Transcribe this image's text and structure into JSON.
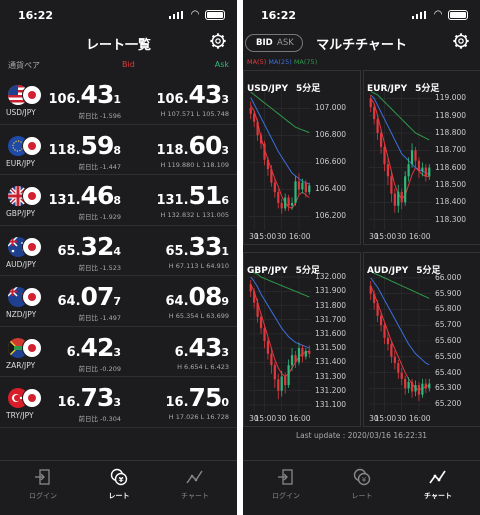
{
  "left": {
    "time": "16:22",
    "title": "レート一覧",
    "columns": {
      "pair": "通貨ペア",
      "bid": "Bid",
      "ask": "Ask"
    },
    "rows": [
      {
        "pair": "USD/JPY",
        "flag": "us-flag",
        "bid": {
          "pre": "106.",
          "big": "43",
          "last": "1"
        },
        "ask": {
          "pre": "106.",
          "big": "43",
          "last": "3"
        },
        "change": "前日比 -1.596",
        "hl": "H 107.571  L 105.748"
      },
      {
        "pair": "EUR/JPY",
        "flag": "eu-flag",
        "bid": {
          "pre": "118.",
          "big": "59",
          "last": "8"
        },
        "ask": {
          "pre": "118.",
          "big": "60",
          "last": "3"
        },
        "change": "前日比 -1.447",
        "hl": "H 119.880  L 118.109"
      },
      {
        "pair": "GBP/JPY",
        "flag": "uk-flag",
        "bid": {
          "pre": "131.",
          "big": "46",
          "last": "8"
        },
        "ask": {
          "pre": "131.",
          "big": "51",
          "last": "6"
        },
        "change": "前日比 -1.929",
        "hl": "H 132.832  L 131.005"
      },
      {
        "pair": "AUD/JPY",
        "flag": "au-flag",
        "bid": {
          "pre": "65.",
          "big": "32",
          "last": "4"
        },
        "ask": {
          "pre": "65.",
          "big": "33",
          "last": "1"
        },
        "change": "前日比 -1.523",
        "hl": "H 67.113  L 64.910"
      },
      {
        "pair": "NZD/JPY",
        "flag": "nz-flag",
        "bid": {
          "pre": "64.",
          "big": "07",
          "last": "7"
        },
        "ask": {
          "pre": "64.",
          "big": "08",
          "last": "9"
        },
        "change": "前日比 -1.497",
        "hl": "H 65.354  L 63.699"
      },
      {
        "pair": "ZAR/JPY",
        "flag": "za-flag",
        "bid": {
          "pre": "6.",
          "big": "42",
          "last": "3"
        },
        "ask": {
          "pre": "6.",
          "big": "43",
          "last": "3"
        },
        "change": "前日比 -0.209",
        "hl": "H 6.654  L 6.423"
      },
      {
        "pair": "TRY/JPY",
        "flag": "tr-flag",
        "bid": {
          "pre": "16.",
          "big": "73",
          "last": "3"
        },
        "ask": {
          "pre": "16.",
          "big": "75",
          "last": "0"
        },
        "change": "前日比 -0.304",
        "hl": "H 17.026  L 16.728"
      }
    ],
    "tabs": [
      {
        "label": "ログイン",
        "icon": "login-icon"
      },
      {
        "label": "レート",
        "icon": "rate-icon"
      },
      {
        "label": "チャート",
        "icon": "chart-icon"
      }
    ],
    "active_tab": "レート"
  },
  "right": {
    "time": "16:22",
    "title": "マルチチャート",
    "toggle": {
      "bid": "BID",
      "ask": "ASK"
    },
    "ma": [
      {
        "label": "MA(5)",
        "color": "#e0383e"
      },
      {
        "label": "MA(25)",
        "color": "#3b6fe0"
      },
      {
        "label": "MA(75)",
        "color": "#2e9a4a"
      }
    ],
    "last_update": "Last update : 2020/03/16 16:22:31",
    "tabs": [
      {
        "label": "ログイン",
        "icon": "login-icon"
      },
      {
        "label": "レート",
        "icon": "rate-icon"
      },
      {
        "label": "チャート",
        "icon": "chart-icon"
      }
    ],
    "active_tab": "チャート"
  },
  "colors": {
    "bid": "#e0383e",
    "ask": "#2eb87a",
    "background": "#1c1c1e",
    "candle_up": "#2eb87a",
    "candle_down": "#e0383e"
  },
  "chart_data": [
    {
      "type": "candlestick",
      "title": "USD/JPY",
      "interval": "5分足",
      "yticks": [
        "107.000",
        "106.800",
        "106.600",
        "106.400",
        "106.200"
      ],
      "ylim": [
        106.1,
        107.15
      ],
      "xticks": [
        "30",
        "15:00",
        "30",
        "16:00"
      ],
      "ma": {
        "MA(5)": [
          107.02,
          106.98,
          106.9,
          106.78,
          106.7,
          106.62,
          106.55,
          106.48,
          106.42,
          106.35,
          106.3,
          106.27,
          106.26,
          106.3,
          106.36,
          106.38,
          106.36,
          106.34
        ],
        "MA(25)": [
          107.08,
          107.03,
          106.98,
          106.93,
          106.88,
          106.83,
          106.78,
          106.73,
          106.68,
          106.64,
          106.6,
          106.56,
          106.52,
          106.5,
          106.48,
          106.46,
          106.45,
          106.44
        ],
        "MA(75)": [
          107.12,
          107.1,
          107.08,
          107.06,
          107.04,
          107.02,
          107.0,
          106.98,
          106.96,
          106.94,
          106.92,
          106.9,
          106.88,
          106.86,
          106.85,
          106.84,
          106.83,
          106.82
        ]
      },
      "candles": [
        [
          107.0,
          106.96,
          107.05,
          106.92
        ],
        [
          106.96,
          106.9,
          106.98,
          106.86
        ],
        [
          106.9,
          106.8,
          106.92,
          106.76
        ],
        [
          106.8,
          106.74,
          106.82,
          106.7
        ],
        [
          106.74,
          106.62,
          106.76,
          106.58
        ],
        [
          106.62,
          106.55,
          106.64,
          106.5
        ],
        [
          106.55,
          106.45,
          106.58,
          106.42
        ],
        [
          106.45,
          106.38,
          106.48,
          106.34
        ],
        [
          106.38,
          106.3,
          106.4,
          106.26
        ],
        [
          106.3,
          106.26,
          106.33,
          106.22
        ],
        [
          106.26,
          106.34,
          106.37,
          106.24
        ],
        [
          106.34,
          106.28,
          106.36,
          106.24
        ],
        [
          106.28,
          106.3,
          106.34,
          106.25
        ],
        [
          106.3,
          106.46,
          106.5,
          106.28
        ],
        [
          106.46,
          106.4,
          106.52,
          106.36
        ],
        [
          106.4,
          106.45,
          106.48,
          106.37
        ],
        [
          106.45,
          106.38,
          106.47,
          106.34
        ],
        [
          106.38,
          106.43,
          106.45,
          106.36
        ]
      ]
    },
    {
      "type": "candlestick",
      "title": "EUR/JPY",
      "interval": "5分足",
      "yticks": [
        "119.000",
        "118.900",
        "118.800",
        "118.700",
        "118.600",
        "118.500",
        "118.400",
        "118.300"
      ],
      "ylim": [
        118.24,
        119.06
      ],
      "xticks": [
        "30",
        "15:00",
        "30",
        "16:00"
      ],
      "ma": {
        "MA(5)": [
          119.0,
          118.97,
          118.9,
          118.82,
          118.74,
          118.66,
          118.58,
          118.5,
          118.45,
          118.42,
          118.44,
          118.5,
          118.56,
          118.6,
          118.58,
          118.56,
          118.55,
          118.55
        ],
        "MA(25)": [
          119.02,
          119.0,
          118.96,
          118.92,
          118.88,
          118.84,
          118.8,
          118.76,
          118.72,
          118.68,
          118.66,
          118.64,
          118.62,
          118.6,
          118.59,
          118.58,
          118.57,
          118.56
        ],
        "MA(75)": [
          119.04,
          119.03,
          119.02,
          119.0,
          118.98,
          118.96,
          118.94,
          118.92,
          118.9,
          118.88,
          118.86,
          118.84,
          118.82,
          118.8,
          118.79,
          118.78,
          118.77,
          118.76
        ]
      },
      "candles": [
        [
          119.0,
          118.95,
          119.02,
          118.92
        ],
        [
          118.95,
          118.88,
          118.97,
          118.85
        ],
        [
          118.88,
          118.8,
          118.9,
          118.76
        ],
        [
          118.8,
          118.72,
          118.82,
          118.68
        ],
        [
          118.72,
          118.62,
          118.74,
          118.58
        ],
        [
          118.62,
          118.55,
          118.66,
          118.5
        ],
        [
          118.55,
          118.45,
          118.58,
          118.4
        ],
        [
          118.45,
          118.38,
          118.48,
          118.34
        ],
        [
          118.38,
          118.46,
          118.5,
          118.34
        ],
        [
          118.46,
          118.4,
          118.48,
          118.36
        ],
        [
          118.4,
          118.55,
          118.58,
          118.38
        ],
        [
          118.55,
          118.62,
          118.66,
          118.52
        ],
        [
          118.62,
          118.7,
          118.74,
          118.6
        ],
        [
          118.7,
          118.64,
          118.72,
          118.6
        ],
        [
          118.64,
          118.58,
          118.66,
          118.54
        ],
        [
          118.58,
          118.6,
          118.63,
          118.55
        ],
        [
          118.6,
          118.55,
          118.62,
          118.52
        ],
        [
          118.55,
          118.6,
          118.62,
          118.53
        ]
      ]
    },
    {
      "type": "candlestick",
      "title": "GBP/JPY",
      "interval": "5分足",
      "yticks": [
        "132.000",
        "131.900",
        "131.800",
        "131.700",
        "131.600",
        "131.500",
        "131.400",
        "131.300",
        "131.200",
        "131.100"
      ],
      "ylim": [
        131.05,
        132.05
      ],
      "xticks": [
        "30",
        "15:00",
        "30",
        "16:00"
      ],
      "ma": {
        "MA(5)": [
          131.95,
          131.9,
          131.82,
          131.74,
          131.66,
          131.58,
          131.5,
          131.42,
          131.36,
          131.32,
          131.3,
          131.32,
          131.36,
          131.4,
          131.44,
          131.46,
          131.47,
          131.48
        ],
        "MA(25)": [
          132.0,
          131.97,
          131.93,
          131.88,
          131.84,
          131.8,
          131.76,
          131.72,
          131.68,
          131.64,
          131.61,
          131.58,
          131.56,
          131.54,
          131.53,
          131.52,
          131.51,
          131.5
        ],
        "MA(75)": [
          132.04,
          132.03,
          132.02,
          132.0,
          131.99,
          131.98,
          131.97,
          131.96,
          131.95,
          131.94,
          131.93,
          131.92,
          131.91,
          131.9,
          131.89,
          131.88,
          131.87,
          131.86
        ]
      },
      "candles": [
        [
          131.95,
          131.9,
          131.98,
          131.86
        ],
        [
          131.9,
          131.82,
          131.92,
          131.78
        ],
        [
          131.82,
          131.72,
          131.85,
          131.68
        ],
        [
          131.72,
          131.64,
          131.75,
          131.6
        ],
        [
          131.64,
          131.55,
          131.67,
          131.5
        ],
        [
          131.55,
          131.46,
          131.58,
          131.42
        ],
        [
          131.46,
          131.38,
          131.5,
          131.32
        ],
        [
          131.38,
          131.28,
          131.4,
          131.22
        ],
        [
          131.28,
          131.2,
          131.32,
          131.14
        ],
        [
          131.2,
          131.3,
          131.34,
          131.16
        ],
        [
          131.3,
          131.24,
          131.33,
          131.18
        ],
        [
          131.24,
          131.38,
          131.42,
          131.22
        ],
        [
          131.38,
          131.45,
          131.5,
          131.34
        ],
        [
          131.45,
          131.4,
          131.48,
          131.36
        ],
        [
          131.4,
          131.5,
          131.54,
          131.38
        ],
        [
          131.5,
          131.44,
          131.52,
          131.4
        ],
        [
          131.44,
          131.48,
          131.5,
          131.42
        ],
        [
          131.48,
          131.46,
          131.52,
          131.43
        ]
      ]
    },
    {
      "type": "candlestick",
      "title": "AUD/JPY",
      "interval": "5分足",
      "yticks": [
        "66.000",
        "65.900",
        "65.800",
        "65.700",
        "65.600",
        "65.500",
        "65.400",
        "65.300",
        "65.200"
      ],
      "ylim": [
        65.15,
        66.05
      ],
      "xticks": [
        "30",
        "15:00",
        "30",
        "16:00"
      ],
      "ma": {
        "MA(5)": [
          65.95,
          65.9,
          65.84,
          65.78,
          65.72,
          65.66,
          65.6,
          65.55,
          65.5,
          65.45,
          65.4,
          65.36,
          65.33,
          65.3,
          65.29,
          65.3,
          65.31,
          65.32
        ],
        "MA(25)": [
          66.0,
          65.97,
          65.94,
          65.9,
          65.86,
          65.82,
          65.78,
          65.74,
          65.7,
          65.66,
          65.62,
          65.58,
          65.55,
          65.52,
          65.5,
          65.48,
          65.46,
          65.45
        ],
        "MA(75)": [
          66.04,
          66.03,
          66.02,
          66.01,
          66.0,
          65.99,
          65.98,
          65.97,
          65.96,
          65.95,
          65.94,
          65.93,
          65.92,
          65.91,
          65.9,
          65.89,
          65.88,
          65.87
        ]
      },
      "candles": [
        [
          65.95,
          65.9,
          65.98,
          65.86
        ],
        [
          65.9,
          65.84,
          65.92,
          65.8
        ],
        [
          65.84,
          65.76,
          65.86,
          65.72
        ],
        [
          65.76,
          65.7,
          65.79,
          65.66
        ],
        [
          65.7,
          65.62,
          65.72,
          65.58
        ],
        [
          65.62,
          65.58,
          65.66,
          65.54
        ],
        [
          65.58,
          65.5,
          65.6,
          65.46
        ],
        [
          65.5,
          65.46,
          65.54,
          65.42
        ],
        [
          65.46,
          65.4,
          65.48,
          65.36
        ],
        [
          65.4,
          65.36,
          65.43,
          65.32
        ],
        [
          65.36,
          65.3,
          65.38,
          65.26
        ],
        [
          65.3,
          65.34,
          65.37,
          65.27
        ],
        [
          65.34,
          65.28,
          65.36,
          65.24
        ],
        [
          65.28,
          65.32,
          65.35,
          65.25
        ],
        [
          65.32,
          65.26,
          65.34,
          65.22
        ],
        [
          65.26,
          65.33,
          65.36,
          65.24
        ],
        [
          65.33,
          65.3,
          65.36,
          65.27
        ],
        [
          65.3,
          65.33,
          65.36,
          65.28
        ]
      ]
    }
  ]
}
